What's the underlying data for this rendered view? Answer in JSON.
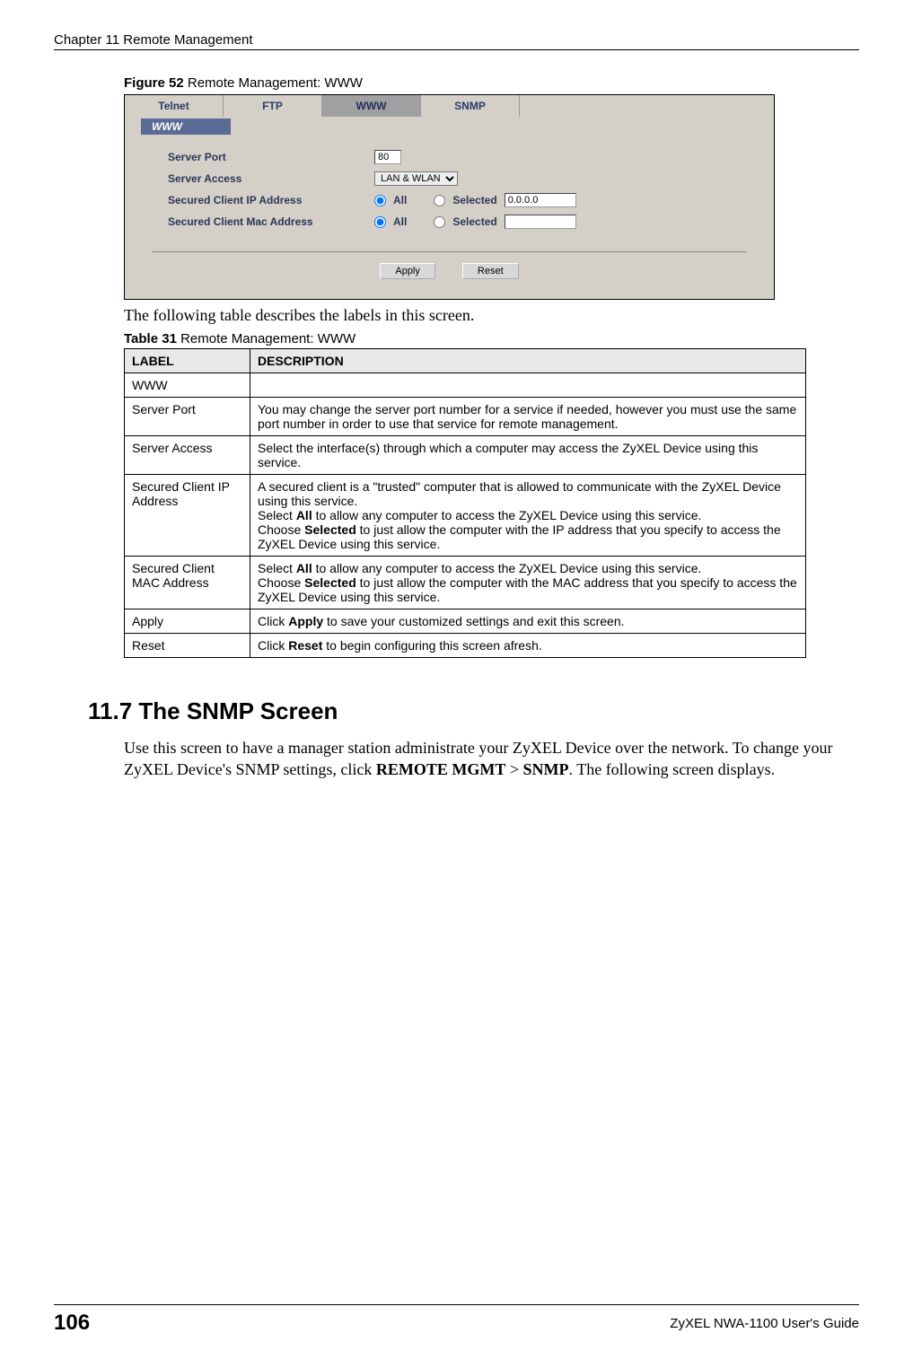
{
  "header": {
    "chapter": "Chapter 11 Remote Management"
  },
  "figure": {
    "label": "Figure 52",
    "title": "   Remote Management: WWW"
  },
  "screenshot": {
    "tabs": {
      "telnet": "Telnet",
      "ftp": "FTP",
      "www": "WWW",
      "snmp": "SNMP"
    },
    "panel_title": "WWW",
    "rows": {
      "server_port": {
        "label": "Server Port",
        "value": "80"
      },
      "server_access": {
        "label": "Server Access",
        "value": "LAN & WLAN"
      },
      "secured_ip": {
        "label": "Secured Client IP Address",
        "all": "All",
        "selected": "Selected",
        "ip_value": "0.0.0.0"
      },
      "secured_mac": {
        "label": "Secured Client Mac Address",
        "all": "All",
        "selected": "Selected",
        "mac_value": ""
      }
    },
    "buttons": {
      "apply": "Apply",
      "reset": "Reset"
    }
  },
  "intro_text": "The following table describes the labels in this screen.",
  "table": {
    "label": "Table 31",
    "title": "   Remote Management: WWW",
    "head": {
      "c1": "LABEL",
      "c2": "DESCRIPTION"
    },
    "rows": [
      {
        "label": "WWW",
        "desc": ""
      },
      {
        "label": "Server Port",
        "desc": "You may change the server port number for a service if needed, however you must use the same port number in order to use that service for remote management."
      },
      {
        "label": "Server Access",
        "desc": "Select the interface(s) through which a computer may access the ZyXEL Device using this service."
      },
      {
        "label": "Secured Client IP Address",
        "desc_pre": "A secured client is a \"trusted\" computer that is allowed to communicate with the ZyXEL Device using this service.",
        "desc_line2_a": "Select ",
        "desc_line2_b": "All",
        "desc_line2_c": " to allow any computer to access the ZyXEL Device using this service.",
        "desc_line3_a": "Choose ",
        "desc_line3_b": "Selected",
        "desc_line3_c": " to just allow the computer with the IP address that you specify to access the ZyXEL Device using this service."
      },
      {
        "label": "Secured Client MAC Address",
        "desc_line1_a": "Select ",
        "desc_line1_b": "All",
        "desc_line1_c": " to allow any computer to access the ZyXEL Device using this service.",
        "desc_line2_a": "Choose ",
        "desc_line2_b": "Selected",
        "desc_line2_c": " to just allow the computer with the MAC address that you specify to access the ZyXEL Device using this service."
      },
      {
        "label": "Apply",
        "desc_a": "Click ",
        "desc_b": "Apply",
        "desc_c": " to save your customized settings and exit this screen."
      },
      {
        "label": "Reset",
        "desc_a": "Click ",
        "desc_b": "Reset",
        "desc_c": " to begin configuring this screen afresh."
      }
    ]
  },
  "section": {
    "number": "11.7",
    "title": "  The SNMP Screen",
    "body_a": "Use this screen to have a manager station administrate your ZyXEL Device over the network. To change your ZyXEL Device's SNMP settings, click ",
    "body_b": "REMOTE MGMT",
    "body_gt": " > ",
    "body_c": "SNMP",
    "body_d": ". The following screen displays."
  },
  "footer": {
    "page": "106",
    "guide": "ZyXEL NWA-1100 User's Guide"
  }
}
